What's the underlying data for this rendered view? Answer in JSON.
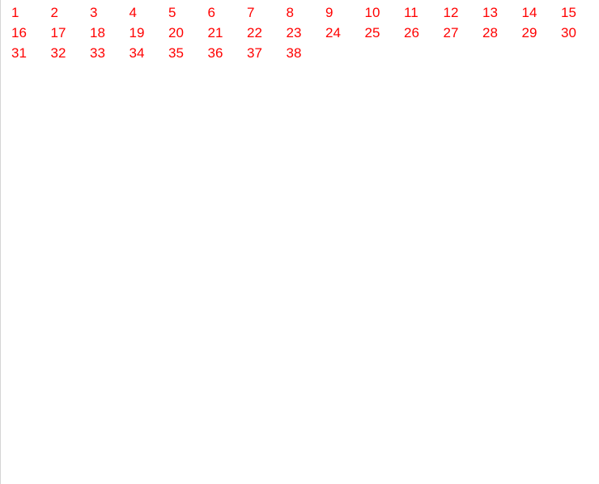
{
  "accent_color": "#ff0000",
  "numbers": [
    "1",
    "2",
    "3",
    "4",
    "5",
    "6",
    "7",
    "8",
    "9",
    "10",
    "11",
    "12",
    "13",
    "14",
    "15",
    "16",
    "17",
    "18",
    "19",
    "20",
    "21",
    "22",
    "23",
    "24",
    "25",
    "26",
    "27",
    "28",
    "29",
    "30",
    "31",
    "32",
    "33",
    "34",
    "35",
    "36",
    "37",
    "38"
  ]
}
